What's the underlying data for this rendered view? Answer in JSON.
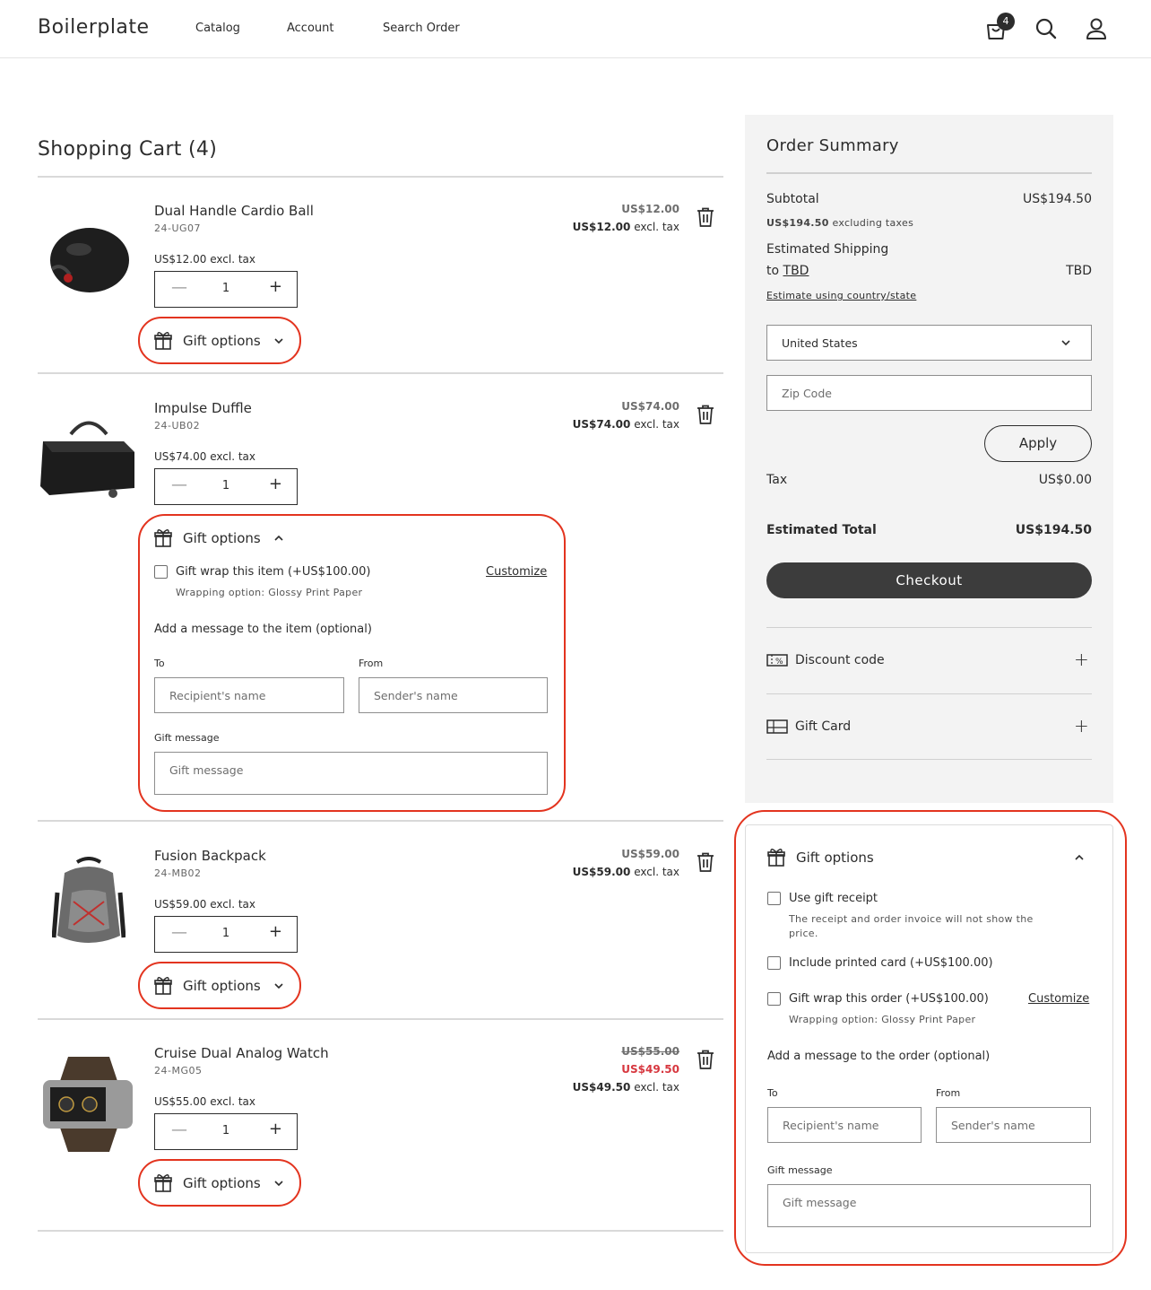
{
  "header": {
    "brand": "Boilerplate",
    "nav": [
      "Catalog",
      "Account",
      "Search Order"
    ],
    "cart_count": "4"
  },
  "cart": {
    "title": "Shopping Cart (4)",
    "qty_value": "1",
    "excl_tax": "excl. tax",
    "gift_label": "Gift options",
    "items": [
      {
        "name": "Dual Handle Cardio Ball",
        "sku": "24-UG07",
        "unit_price": "US$12.00",
        "row_price": "US$12.00",
        "row_price_excl": "US$12.00"
      },
      {
        "name": "Impulse Duffle",
        "sku": "24-UB02",
        "unit_price": "US$74.00",
        "row_price": "US$74.00",
        "row_price_excl": "US$74.00"
      },
      {
        "name": "Fusion Backpack",
        "sku": "24-MB02",
        "unit_price": "US$59.00",
        "row_price": "US$59.00",
        "row_price_excl": "US$59.00"
      },
      {
        "name": "Cruise Dual Analog Watch",
        "sku": "24-MG05",
        "unit_price": "US$55.00",
        "row_price": "US$55.00",
        "sale_price": "US$49.50",
        "row_price_excl": "US$49.50"
      }
    ],
    "item_gift": {
      "wrap_label": "Gift wrap this item (+US$100.00)",
      "customize": "Customize",
      "wrap_option": "Wrapping option: Glossy Print Paper",
      "message_heading": "Add a message to the item (optional)",
      "to_label": "To",
      "from_label": "From",
      "to_placeholder": "Recipient's name",
      "from_placeholder": "Sender's name",
      "message_label": "Gift message",
      "message_placeholder": "Gift message"
    }
  },
  "summary": {
    "title": "Order Summary",
    "subtotal_label": "Subtotal",
    "subtotal_value": "US$194.50",
    "subtotal_excl_value": "US$194.50",
    "subtotal_excl_text": "excluding taxes",
    "shipping_label": "Estimated Shipping",
    "shipping_to": "to",
    "shipping_to_link": "TBD",
    "shipping_value": "TBD",
    "estimate_link": "Estimate using country/state",
    "country": "United States",
    "zip_placeholder": "Zip Code",
    "apply": "Apply",
    "tax_label": "Tax",
    "tax_value": "US$0.00",
    "total_label": "Estimated Total",
    "total_value": "US$194.50",
    "checkout": "Checkout",
    "discount_label": "Discount code",
    "giftcard_label": "Gift Card"
  },
  "order_gift": {
    "title": "Gift options",
    "receipt_label": "Use gift receipt",
    "receipt_note_1": "The receipt and order invoice will not show the",
    "receipt_note_2": "price.",
    "printed_card": "Include printed card (+US$100.00)",
    "wrap_label": "Gift wrap this order (+US$100.00)",
    "customize": "Customize",
    "wrap_option": "Wrapping option: Glossy Print Paper",
    "message_heading": "Add a message to the order (optional)",
    "to_label": "To",
    "from_label": "From",
    "to_placeholder": "Recipient's name",
    "from_placeholder": "Sender's name",
    "message_label": "Gift message",
    "message_placeholder": "Gift message"
  },
  "colors": {
    "accent_dark": "#3c3c3c",
    "highlight_ring": "#e3341f",
    "sale_red": "#d7373f",
    "panel_bg": "#f3f3f3"
  }
}
